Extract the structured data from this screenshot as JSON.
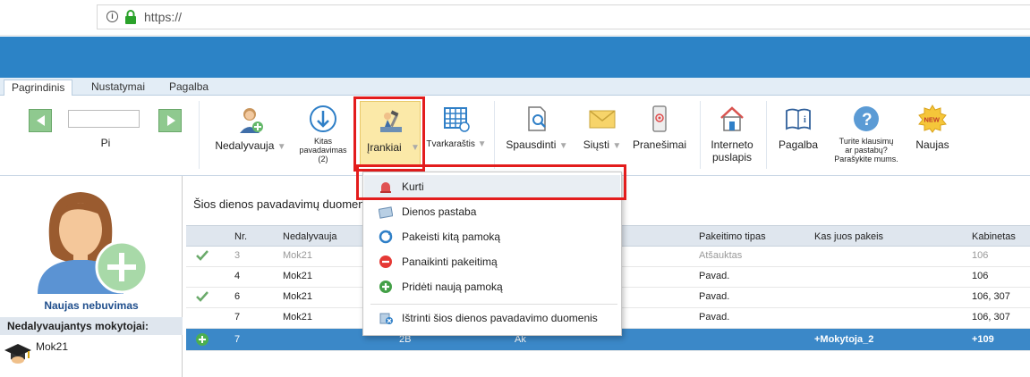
{
  "browser": {
    "url": "https://"
  },
  "tabs": [
    "Pagrindinis",
    "Nustatymai",
    "Pagalba"
  ],
  "ribbon": {
    "date_value": "",
    "period_label": "Pi",
    "nedalyvauja": "Nedalyvauja",
    "kitas1": "Kitas",
    "kitas2": "pavadavimas",
    "kitas3": "(2)",
    "irankiai": "Įrankiai",
    "tvarkarastis": "Tvarkaraštis",
    "spausdinti": "Spausdinti",
    "siusti": "Siųsti",
    "pranesimai": "Pranešimai",
    "internet1": "Interneto",
    "internet2": "puslapis",
    "pagalba": "Pagalba",
    "q1": "Turite klausimų",
    "q2": "ar pastabų?",
    "q3": "Parašykite mums.",
    "naujas": "Naujas",
    "new_badge": "NEW"
  },
  "left_panel": {
    "title": "Naujas nebuvimas",
    "absent_header": "Nedalyvaujantys mokytojai:",
    "teacher": "Mok21"
  },
  "main": {
    "title": "Šios dienos pavadavimų duomeny"
  },
  "table": {
    "headers": {
      "nr": "Nr.",
      "nedalyvauja": "Nedalyvauja",
      "tipas": "Pakeitimo tipas",
      "kas": "Kas juos pakeis",
      "kabinetas": "Kabinetas"
    },
    "rows": [
      {
        "nr": "3",
        "nedalyvauja": "Mok21",
        "tipas": "Atšauktas",
        "kas": "",
        "kabinetas": "106"
      },
      {
        "nr": "4",
        "nedalyvauja": "Mok21",
        "tipas": "Pavad.",
        "kas": "",
        "kabinetas": "106"
      },
      {
        "nr": "6",
        "nedalyvauja": "Mok21",
        "tipas": "Pavad.",
        "kas": "",
        "kabinetas": "106, 307"
      },
      {
        "nr": "7",
        "nedalyvauja": "Mok21",
        "tipas": "Pavad.",
        "kas": "",
        "kabinetas": "106, 307"
      }
    ],
    "selected_row": {
      "nr": "7",
      "klase": "2B",
      "dalykas": "Ak",
      "kas": "+Mokytoja_2",
      "kabinetas": "+109"
    }
  },
  "menu": {
    "items": [
      "Kurti",
      "Dienos pastaba",
      "Pakeisti kitą pamoką",
      "Panaikinti pakeitimą",
      "Pridėti naują pamoką",
      "Ištrinti šios dienos pavadavimo duomenis"
    ]
  }
}
